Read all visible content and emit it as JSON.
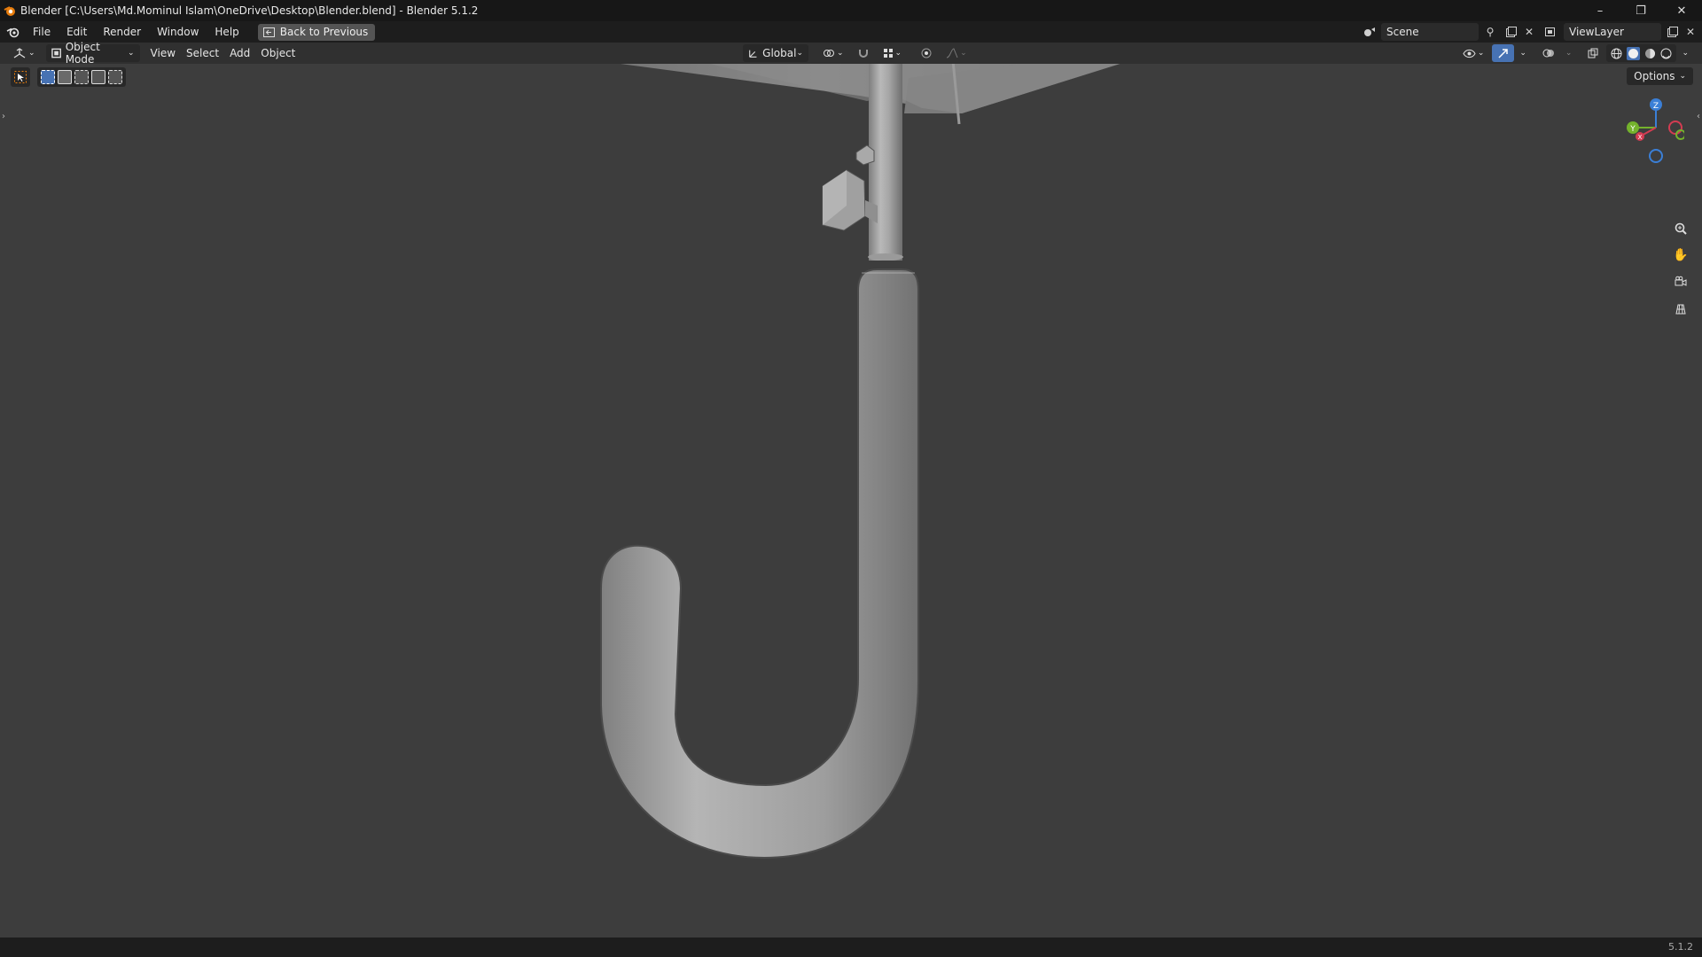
{
  "titlebar": {
    "title": "Blender [C:\\Users\\Md.Mominul Islam\\OneDrive\\Desktop\\Blender.blend] - Blender 5.1.2",
    "minimize": "–",
    "maximize": "❐",
    "close": "✕"
  },
  "menubar": {
    "items": [
      "File",
      "Edit",
      "Render",
      "Window",
      "Help"
    ],
    "back_button": "Back to Previous",
    "scene": "Scene",
    "view_layer": "ViewLayer"
  },
  "header3d": {
    "mode": "Object Mode",
    "menus": [
      "View",
      "Select",
      "Add",
      "Object"
    ],
    "transform_orientation": "Global"
  },
  "viewport": {
    "options_label": "Options",
    "gizmo": {
      "z": "Z",
      "y": "Y",
      "x": "X"
    }
  },
  "statusbar": {
    "version": "5.1.2"
  },
  "colors": {
    "accent": "#4772b3",
    "background": "#3d3d3d",
    "gizmo_x": "#d43c52",
    "gizmo_y": "#74b22c",
    "gizmo_z": "#3b7fd6"
  }
}
